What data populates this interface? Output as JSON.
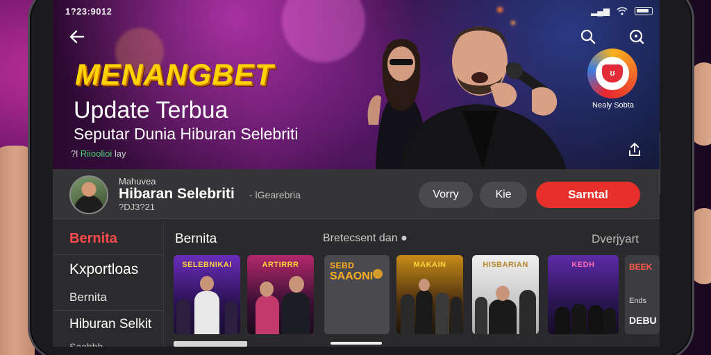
{
  "status_bar": {
    "time": "1?23:9012"
  },
  "hero": {
    "title": "MENANGBET",
    "subtitle": "Update Terbua",
    "tagline": "Seputar Dunia Hiburan Selebriti",
    "meta_prefix": "?l",
    "meta_highlight": "Riioolioi",
    "meta_suffix": "lay",
    "brand_caption": "Nealy Sobta"
  },
  "channel": {
    "small_label": "Mahuvea",
    "name": "Hibaran Selebriti",
    "extra": "- lGearebria",
    "subline": "?DJ3?21"
  },
  "actions": {
    "btn1": "Vorry",
    "btn2": "Kie",
    "primary": "Sarntal"
  },
  "sidebar": {
    "items": [
      "Bernita",
      "Kxportloas",
      "Bernita",
      "Hiburan Selkit",
      "Saahhh"
    ]
  },
  "section": {
    "title": "Bernita",
    "middle": "Bretecsent dan",
    "right": "Dverjyart"
  },
  "thumbnails": [
    {
      "label": "SELEBNIKAI"
    },
    {
      "label": "ARTIRRR"
    },
    {
      "label": "SEBD",
      "title": "SAAONI"
    },
    {
      "label": "MAKAIN"
    },
    {
      "label": "HISBARIAN"
    },
    {
      "label": "KEDH"
    },
    {
      "label": "BEEK",
      "sub": "Ends",
      "tag": "DEBU"
    }
  ],
  "colors": {
    "accent": "#e8302a",
    "title_yellow": "#ffd400",
    "active_red": "#ff4b4b"
  }
}
